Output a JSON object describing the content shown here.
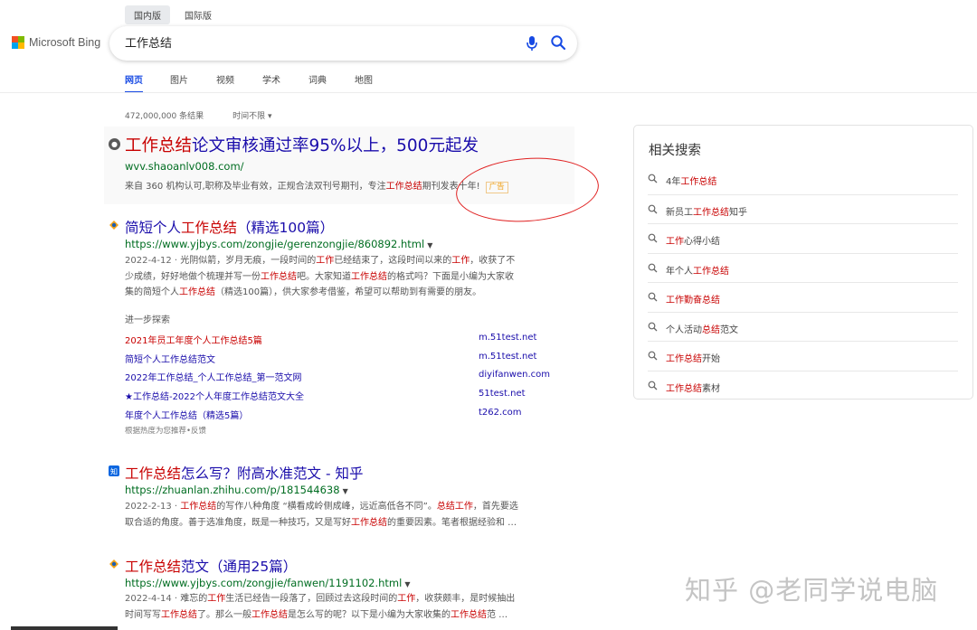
{
  "header": {
    "region_tabs": [
      {
        "label": "国内版",
        "active": true
      },
      {
        "label": "国际版",
        "active": false
      }
    ],
    "logo_text": "Microsoft Bing",
    "search_query": "工作总结",
    "nav_tabs": [
      "网页",
      "图片",
      "视频",
      "学术",
      "词典",
      "地图"
    ]
  },
  "stats": {
    "result_count": "472,000,000 条结果",
    "time_filter": "时间不限 ▾"
  },
  "ad": {
    "title_hl": "工作总结",
    "title_rest": "论文审核通过率95%以上，500元起发",
    "url": "wvv.shaoanlv008.com/",
    "desc_a": "来自 360 机构认可,职称及毕业有效，正规合法双刊号期刊，专注",
    "desc_hl": "工作总结",
    "desc_b": "期刊发表十年!",
    "badge": "广告"
  },
  "result1": {
    "title_a": "简短个人",
    "title_hl": "工作总结",
    "title_b": "（精选100篇）",
    "url": "https://www.yjbys.com/zongjie/gerenzongjie/860892.html",
    "line1_date": "2022-4-12 · ",
    "line1_a": "光阴似箭，岁月无痕，一段时间的",
    "line1_hl": "工作",
    "line1_b": "已经结束了，这段时间以来的",
    "line1_hl2": "工作",
    "line1_c": "，收获了不",
    "line2_a": "少成绩，好好地做个梳理并写一份",
    "line2_hl": "工作总结",
    "line2_b": "吧。大家知道",
    "line2_hl2": "工作总结",
    "line2_c": "的格式吗？下面是小编为大家收",
    "line3_a": "集的简短个人",
    "line3_hl": "工作总结",
    "line3_b": "（精选100篇），供大家参考借鉴，希望可以帮助到有需要的朋友。"
  },
  "explore": {
    "heading": "进一步探索",
    "rows": [
      {
        "link": "2021年员工年度个人工作总结5篇",
        "domain": "m.51test.net"
      },
      {
        "link": "简短个人工作总结范文",
        "domain": "m.51test.net"
      },
      {
        "link": "2022年工作总结_个人工作总结_第一范文网",
        "domain": "diyifanwen.com"
      },
      {
        "link": "★工作总结-2022个人年度工作总结范文大全",
        "domain": "51test.net"
      },
      {
        "link": "年度个人工作总结（精选5篇）",
        "domain": "t262.com"
      }
    ],
    "footer": "根据热度为您推荐•反馈"
  },
  "result2": {
    "title_hl": "工作总结",
    "title_b": "怎么写？附高水准范文 - 知乎",
    "url": "https://zhuanlan.zhihu.com/p/181544638",
    "line1_date": "2022-2-13 · ",
    "line1_hl": "工作总结",
    "line1_a": "的写作八种角度 “横看成岭侧成峰，远近高低各不同”。",
    "line1_hl2": "总结工作",
    "line1_b": "，首先要选",
    "line2_a": "取合适的角度。善于选准角度，既是一种技巧，又是写好",
    "line2_hl": "工作总结",
    "line2_b": "的重要因素。笔者根据经验和 …"
  },
  "result3": {
    "title_hl": "工作总结",
    "title_b": "范文（通用25篇）",
    "url": "https://www.yjbys.com/zongjie/fanwen/1191102.html",
    "line1_date": "2022-4-14 · ",
    "line1_a": "难忘的",
    "line1_hl": "工作",
    "line1_b": "生活已经告一段落了，回顾过去这段时间的",
    "line1_hl2": "工作",
    "line1_c": "，收获颇丰，是时候抽出",
    "line2_a": "时间写写",
    "line2_hl": "工作总结",
    "line2_b": "了。那么一般",
    "line2_hl2": "工作总结",
    "line2_c": "是怎么写的呢？以下是小编为大家收集的",
    "line2_hl3": "工作总结",
    "line2_d": "范 …"
  },
  "related": {
    "title": "相关搜索",
    "items": [
      {
        "a": "4年",
        "hl": "工作总结",
        "b": ""
      },
      {
        "a": "新员工",
        "hl": "工作总结",
        "b": "知乎"
      },
      {
        "a": "",
        "hl": "工作",
        "b": "心得小结"
      },
      {
        "a": "年个人",
        "hl": "工作总结",
        "b": ""
      },
      {
        "a": "",
        "hl": "工作勤奋总结",
        "b": ""
      },
      {
        "a": "个人活动",
        "hl": "总结",
        "b": "范文"
      },
      {
        "a": "",
        "hl": "工作总结",
        "b": "开始"
      },
      {
        "a": "",
        "hl": "工作总结",
        "b": "素材"
      }
    ]
  },
  "watermark": "知乎 @老同学说电脑",
  "colors": {
    "link": "#1a0dab",
    "highlight": "#c80000",
    "url": "#006d21",
    "accent": "#174ae4"
  }
}
